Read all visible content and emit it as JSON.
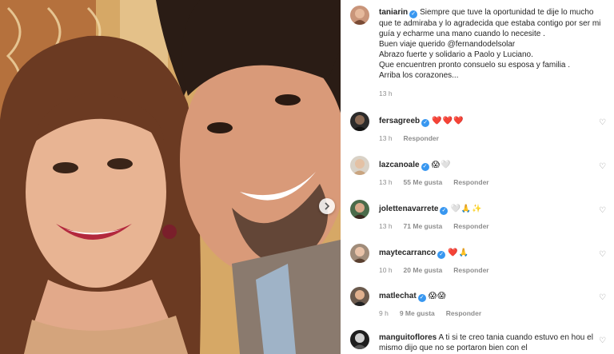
{
  "post": {
    "author": "taniarin",
    "caption_lines": [
      "Siempre que tuve la oportunidad te dije lo mucho",
      "que te admiraba y lo agradecida que estaba contigo por ser mi",
      "guía y echarme una mano cuando lo necesite .",
      "Buen viaje querido @fernandodelsolar",
      "Abrazo fuerte y solidario a Paolo y Luciano.",
      "Que encuentren pronto consuelo su esposa y familia .",
      "Arriba los corazones..."
    ],
    "time": "13 h"
  },
  "comments": [
    {
      "username": "fersagreeb",
      "verified": true,
      "text": "❤️❤️❤️",
      "time": "13 h",
      "likes": "",
      "reply": "Responder"
    },
    {
      "username": "lazcanoale",
      "verified": true,
      "text": "😱🤍",
      "time": "13 h",
      "likes": "55 Me gusta",
      "reply": "Responder"
    },
    {
      "username": "jolettenavarrete",
      "verified": true,
      "text": "🤍🙏✨",
      "time": "13 h",
      "likes": "71 Me gusta",
      "reply": "Responder"
    },
    {
      "username": "maytecarranco",
      "verified": true,
      "text": "❤️🙏",
      "time": "10 h",
      "likes": "20 Me gusta",
      "reply": "Responder"
    },
    {
      "username": "matlechat",
      "verified": true,
      "text": "😱😱",
      "time": "9 h",
      "likes": "9 Me gusta",
      "reply": "Responder"
    },
    {
      "username": "manguitoflores",
      "verified": false,
      "text": "A ti si te creo tania cuando estuvo en hou el",
      "text2": "mismo dijo que no se portaron bien con el",
      "time": "",
      "likes": "",
      "reply": ""
    }
  ],
  "colors": {
    "accent": "#3897f0",
    "meta": "#8e8e8e",
    "text": "#262626"
  },
  "icons": {
    "verified": "verified-badge-icon",
    "next": "chevron-right-icon",
    "like": "heart-outline-icon"
  }
}
